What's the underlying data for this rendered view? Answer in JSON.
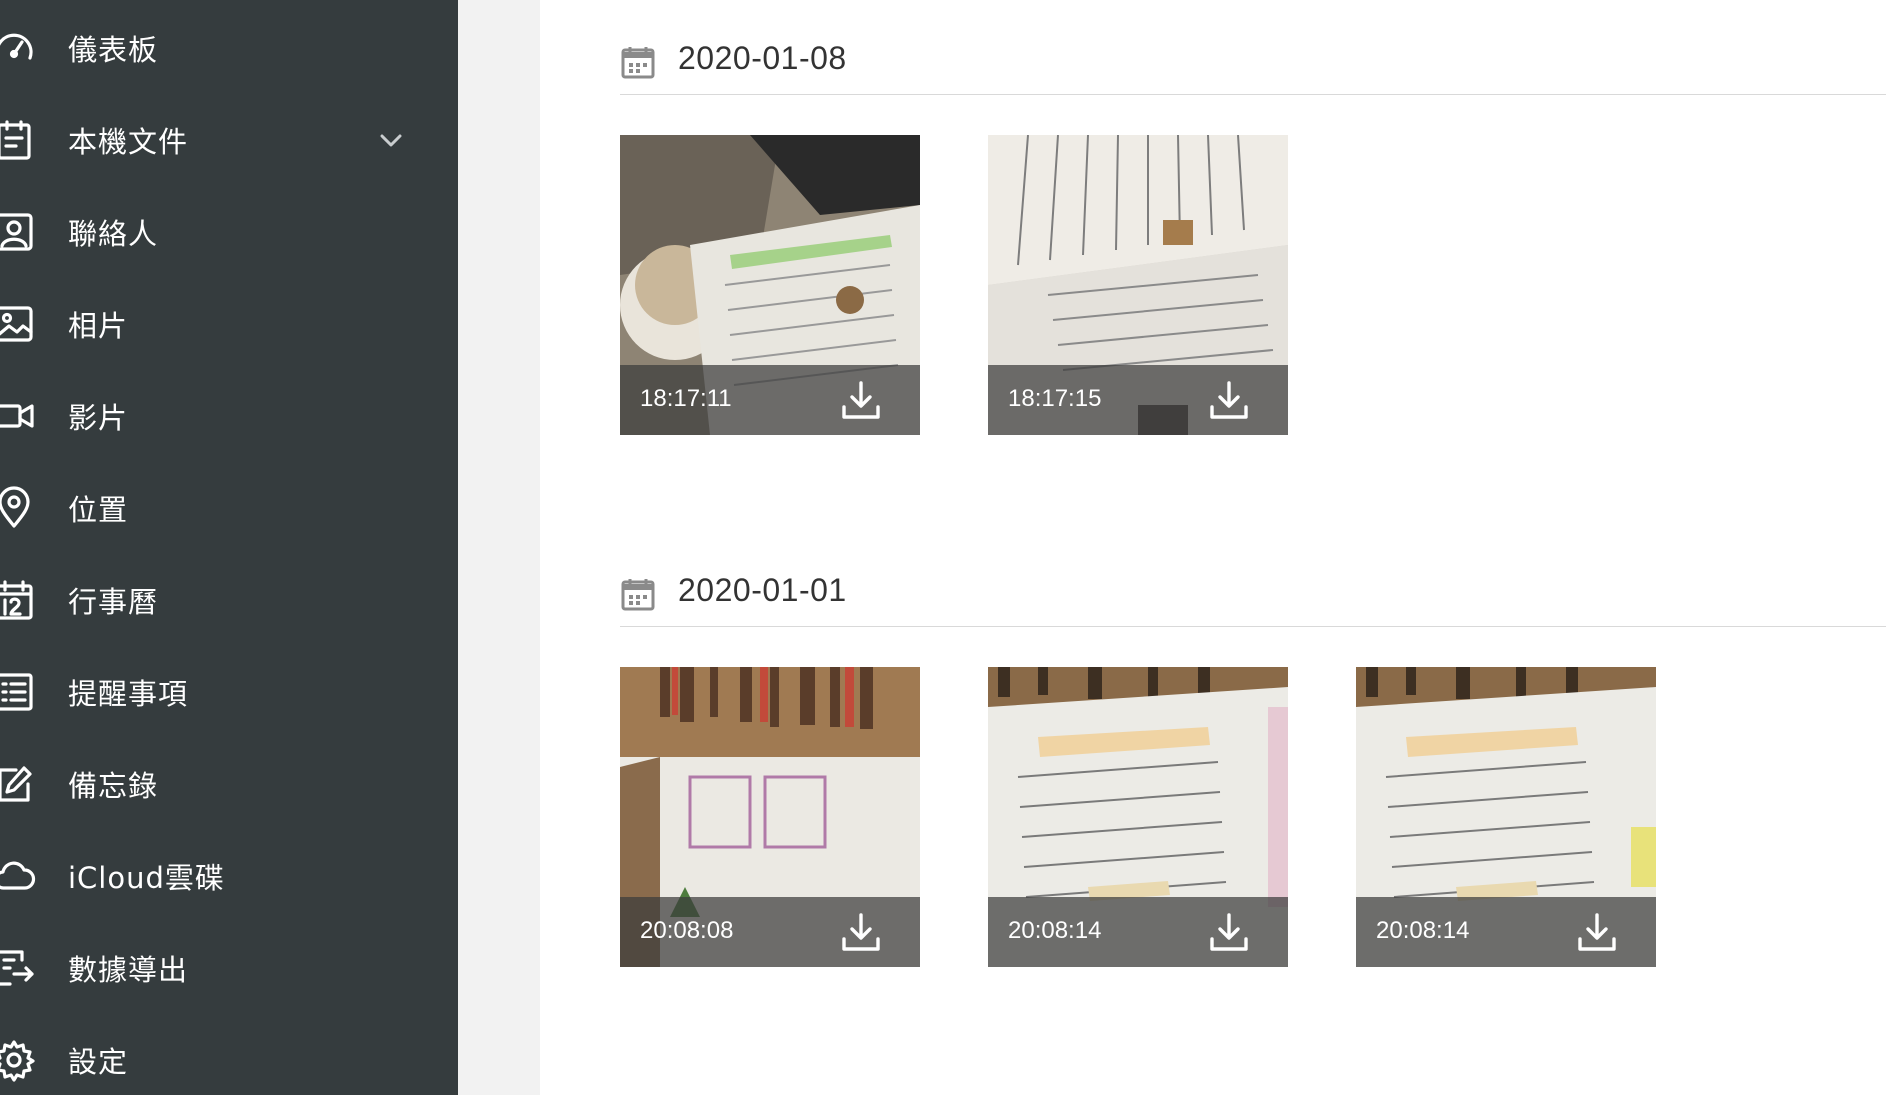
{
  "sidebar": {
    "items": [
      {
        "label": "儀表板",
        "icon": "dashboard-icon"
      },
      {
        "label": "本機文件",
        "icon": "document-icon",
        "expandable": true
      },
      {
        "label": "聯絡人",
        "icon": "contact-icon"
      },
      {
        "label": "相片",
        "icon": "photo-icon"
      },
      {
        "label": "影片",
        "icon": "video-icon"
      },
      {
        "label": "位置",
        "icon": "location-pin-icon"
      },
      {
        "label": "行事曆",
        "icon": "calendar-icon"
      },
      {
        "label": "提醒事項",
        "icon": "list-icon"
      },
      {
        "label": "備忘錄",
        "icon": "note-edit-icon"
      },
      {
        "label": "iCloud雲碟",
        "icon": "cloud-icon"
      },
      {
        "label": "數據導出",
        "icon": "export-icon"
      },
      {
        "label": "設定",
        "icon": "gear-icon"
      }
    ]
  },
  "groups": [
    {
      "date": "2020-01-08",
      "photos": [
        {
          "time": "18:17:11"
        },
        {
          "time": "18:17:15"
        }
      ]
    },
    {
      "date": "2020-01-01",
      "photos": [
        {
          "time": "20:08:08"
        },
        {
          "time": "20:08:14"
        },
        {
          "time": "20:08:14"
        }
      ]
    }
  ],
  "colors": {
    "sidebar_bg": "#353c3e",
    "gutter_bg": "#f2f2f2",
    "content_bg": "#ffffff",
    "text_dark": "#333333"
  }
}
